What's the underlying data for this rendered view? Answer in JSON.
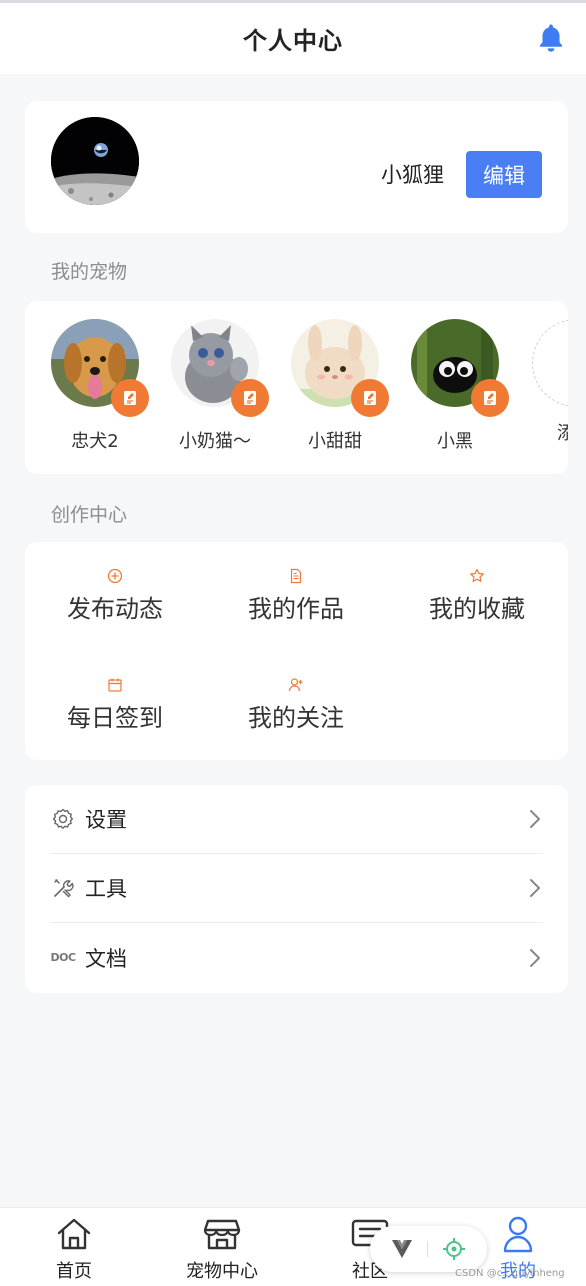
{
  "header": {
    "title": "个人中心"
  },
  "profile": {
    "username": "小狐狸",
    "edit_label": "编辑"
  },
  "pets_section": {
    "title": "我的宠物",
    "pets": [
      {
        "name": "忠犬2"
      },
      {
        "name": "小奶猫～"
      },
      {
        "name": "小甜甜"
      },
      {
        "name": "小黑"
      }
    ],
    "add_label": "添"
  },
  "creation_section": {
    "title": "创作中心",
    "items": [
      {
        "label": "发布动态",
        "icon": "plus-circle-icon"
      },
      {
        "label": "我的作品",
        "icon": "document-icon"
      },
      {
        "label": "我的收藏",
        "icon": "star-icon"
      },
      {
        "label": "每日签到",
        "icon": "calendar-icon"
      },
      {
        "label": "我的关注",
        "icon": "user-add-icon"
      }
    ]
  },
  "settings": {
    "items": [
      {
        "label": "设置",
        "icon": "gear-icon"
      },
      {
        "label": "工具",
        "icon": "tools-icon"
      },
      {
        "label": "文档",
        "icon": "doc-icon"
      }
    ],
    "doc_icon_text": "DOC"
  },
  "tabbar": {
    "items": [
      {
        "label": "首页",
        "icon": "home-icon"
      },
      {
        "label": "宠物中心",
        "icon": "shop-icon"
      },
      {
        "label": "社区",
        "icon": "community-icon"
      },
      {
        "label": "我的",
        "icon": "user-icon"
      }
    ]
  },
  "watermark": "CSDN @c...guyinheng",
  "colors": {
    "accent": "#4a7ef5",
    "orange": "#f07a33",
    "active_tab": "#3b7bf0"
  }
}
